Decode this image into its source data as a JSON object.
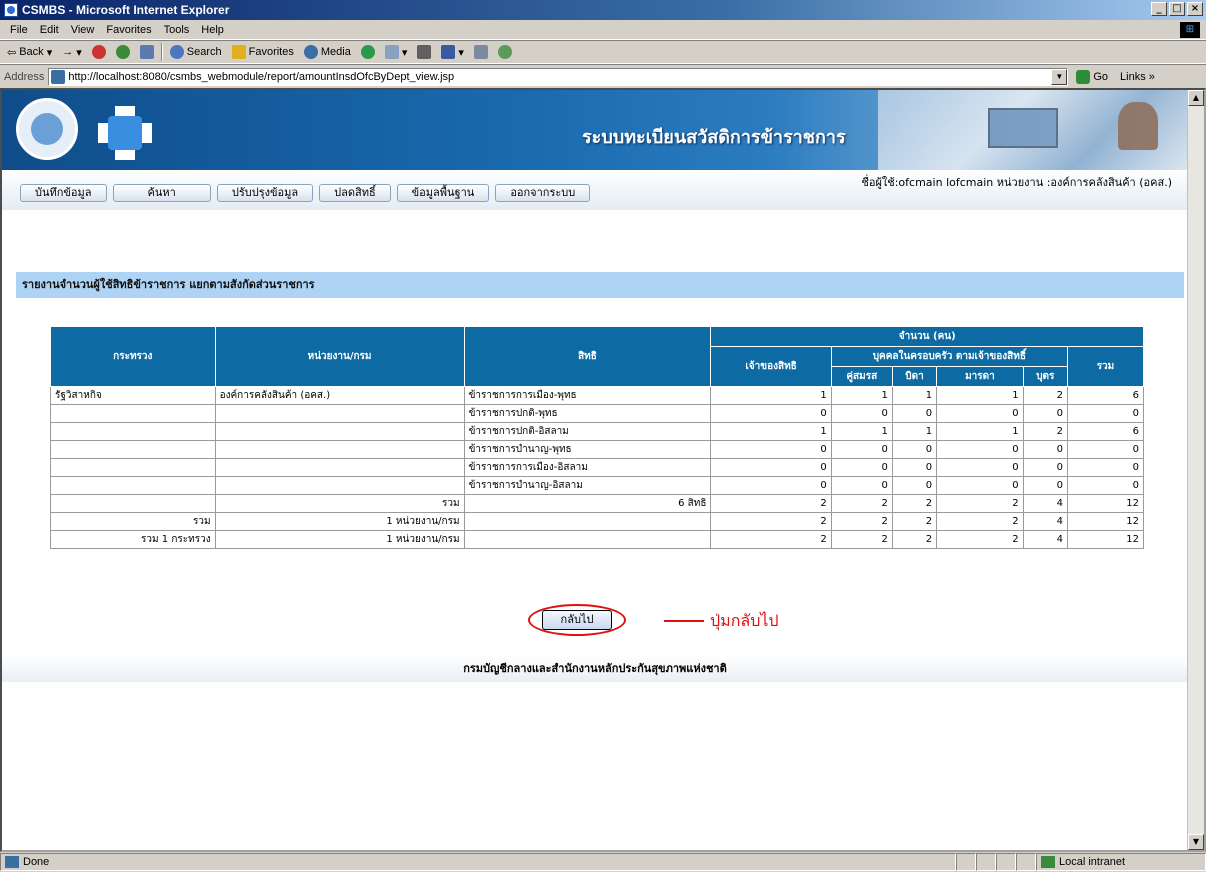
{
  "window": {
    "title": "CSMBS - Microsoft Internet Explorer",
    "controls": [
      "_",
      "□",
      "×"
    ]
  },
  "menu": [
    "File",
    "Edit",
    "View",
    "Favorites",
    "Tools",
    "Help"
  ],
  "toolbar": {
    "back": "Back",
    "forward": "→",
    "search": "Search",
    "favorites": "Favorites",
    "media": "Media"
  },
  "address": {
    "label": "Address",
    "url": "http://localhost:8080/csmbs_webmodule/report/amountInsdOfcByDept_view.jsp",
    "go": "Go",
    "links": "Links »"
  },
  "header": {
    "system_title": "ระบบทะเบียนสวัสดิการข้าราชการ",
    "nav": [
      "บันทึกข้อมูล",
      "ค้นหา",
      "ปรับปรุงข้อมูล",
      "ปลดสิทธิ์",
      "ข้อมูลพื้นฐาน",
      "ออกจากระบบ"
    ],
    "user_info": "ชื่อผู้ใช้:ofcmain lofcmain หน่วยงาน :องค์การคลังสินค้า (อคส.)"
  },
  "report": {
    "title": "รายงานจำนวนผู้ใช้สิทธิข้าราชการ แยกตามสังกัดส่วนราชการ",
    "headers": {
      "ministry": "กระทรวง",
      "department": "หน่วยงาน/กรม",
      "right": "สิทธิ",
      "amount": "จำนวน (คน)",
      "owner": "เจ้าของสิทธิ",
      "family": "บุคคลในครอบครัว ตามเจ้าของสิทธิ์",
      "spouse": "คู่สมรส",
      "father": "บิดา",
      "mother": "มารดา",
      "child": "บุตร",
      "total": "รวม"
    },
    "rows": [
      {
        "ministry": "รัฐวิสาหกิจ",
        "department": "องค์การคลังสินค้า (อคส.)",
        "right": "ข้าราชการการเมือง-พุทธ",
        "owner": "1",
        "spouse": "1",
        "father": "1",
        "mother": "1",
        "child": "2",
        "total": "6"
      },
      {
        "ministry": "",
        "department": "",
        "right": "ข้าราชการปกติ-พุทธ",
        "owner": "0",
        "spouse": "0",
        "father": "0",
        "mother": "0",
        "child": "0",
        "total": "0"
      },
      {
        "ministry": "",
        "department": "",
        "right": "ข้าราชการปกติ-อิสลาม",
        "owner": "1",
        "spouse": "1",
        "father": "1",
        "mother": "1",
        "child": "2",
        "total": "6"
      },
      {
        "ministry": "",
        "department": "",
        "right": "ข้าราชการบำนาญ-พุทธ",
        "owner": "0",
        "spouse": "0",
        "father": "0",
        "mother": "0",
        "child": "0",
        "total": "0"
      },
      {
        "ministry": "",
        "department": "",
        "right": "ข้าราชการการเมือง-อิสลาม",
        "owner": "0",
        "spouse": "0",
        "father": "0",
        "mother": "0",
        "child": "0",
        "total": "0"
      },
      {
        "ministry": "",
        "department": "",
        "right": "ข้าราชการบำนาญ-อิสลาม",
        "owner": "0",
        "spouse": "0",
        "father": "0",
        "mother": "0",
        "child": "0",
        "total": "0"
      },
      {
        "ministry": "",
        "department": "รวม",
        "right": "6 สิทธิ",
        "owner": "2",
        "spouse": "2",
        "father": "2",
        "mother": "2",
        "child": "4",
        "total": "12"
      },
      {
        "ministry": "รวม",
        "department": "1 หน่วยงาน/กรม",
        "right": "",
        "owner": "2",
        "spouse": "2",
        "father": "2",
        "mother": "2",
        "child": "4",
        "total": "12"
      },
      {
        "ministry": "รวม 1 กระทรวง",
        "department": "1 หน่วยงาน/กรม",
        "right": "",
        "owner": "2",
        "spouse": "2",
        "father": "2",
        "mother": "2",
        "child": "4",
        "total": "12"
      }
    ]
  },
  "back_button": "กลับไป",
  "annotation": "ปุ่มกลับไป",
  "footer": "กรมบัญชีกลางและสำนักงานหลักประกันสุขภาพแห่งชาติ",
  "status": {
    "text": "Done",
    "zone": "Local intranet"
  }
}
